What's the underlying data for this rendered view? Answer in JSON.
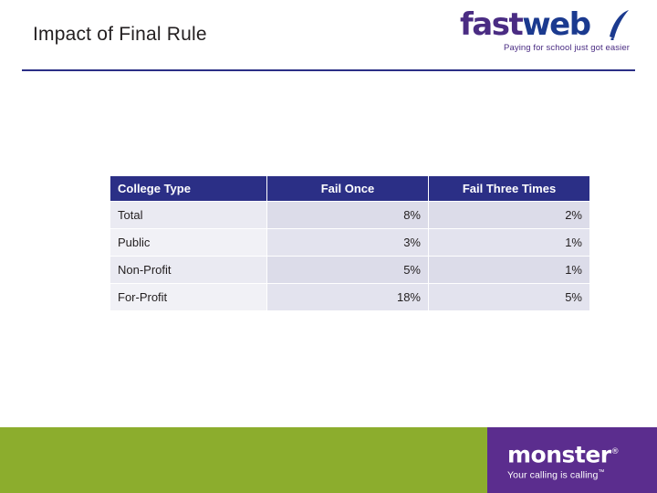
{
  "slide": {
    "title": "Impact of Final Rule"
  },
  "brand": {
    "fastweb": {
      "name_part1": "fast",
      "name_part2": "web",
      "tagline": "Paying for school just got easier",
      "purple": "#4a2c83",
      "blue": "#1b3a8f"
    },
    "monster": {
      "name": "monster",
      "registered": "®",
      "tagline": "Your calling is calling",
      "trademark": "™",
      "purple": "#5b2d8e",
      "green": "#8cad2d"
    }
  },
  "table": {
    "headers": [
      "College Type",
      "Fail Once",
      "Fail Three Times"
    ],
    "rows": [
      [
        "Total",
        "8%",
        "2%"
      ],
      [
        "Public",
        "3%",
        "1%"
      ],
      [
        "Non-Profit",
        "5%",
        "1%"
      ],
      [
        "For-Profit",
        "18%",
        "5%"
      ]
    ]
  },
  "colors": {
    "header_rule": "#2b2f86",
    "table_header_bg": "#2b2f86",
    "cell_label_bg": "#eaeaf2",
    "cell_value_bg": "#dcdce9"
  }
}
